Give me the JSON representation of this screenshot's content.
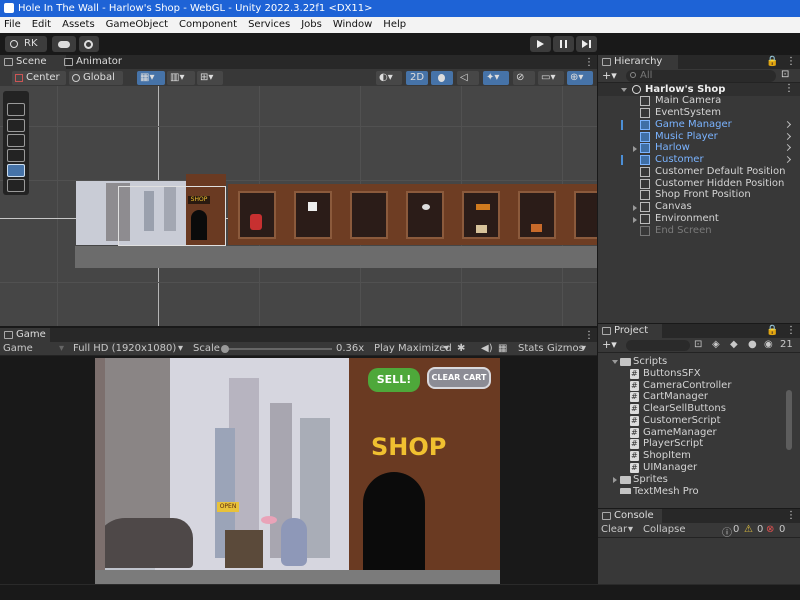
{
  "window": {
    "title": "Hole In The Wall - Harlow's Shop - WebGL - Unity 2022.3.22f1 <DX11>"
  },
  "menu": [
    "File",
    "Edit",
    "Assets",
    "GameObject",
    "Component",
    "Services",
    "Jobs",
    "Window",
    "Help"
  ],
  "toolbar": {
    "account": "RK"
  },
  "scene_panel": {
    "tabs": [
      "Scene",
      "Animator"
    ],
    "pivot": "Center",
    "space": "Global",
    "mode_2d": "2D",
    "shop_sign": "SHOP"
  },
  "hierarchy": {
    "tab": "Hierarchy",
    "search_placeholder": "All",
    "root": "Harlow's Shop",
    "items": [
      {
        "label": "Main Camera"
      },
      {
        "label": "EventSystem"
      },
      {
        "label": "Game Manager"
      },
      {
        "label": "Music Player"
      },
      {
        "label": "Harlow"
      },
      {
        "label": "Customer"
      },
      {
        "label": "Customer Default Position"
      },
      {
        "label": "Customer Hidden Position"
      },
      {
        "label": "Shop Front Position"
      },
      {
        "label": "Canvas"
      },
      {
        "label": "Environment"
      },
      {
        "label": "End Screen"
      }
    ]
  },
  "game_panel": {
    "tab": "Game",
    "display": "Game",
    "resolution": "Full HD (1920x1080)",
    "scale_label": "Scale",
    "scale_value": "0.36x",
    "play_mode": "Play Maximized",
    "stats": "Stats",
    "gizmos": "Gizmos",
    "sell_button": "SELL!",
    "clear_cart_button": "CLEAR CART",
    "shop_sign": "SHOP",
    "open_sign": "OPEN"
  },
  "project": {
    "tab": "Project",
    "count": "21",
    "folder": "Scripts",
    "scripts": [
      "ButtonsSFX",
      "CameraController",
      "CartManager",
      "ClearSellButtons",
      "CustomerScript",
      "GameManager",
      "PlayerScript",
      "ShopItem",
      "UIManager"
    ],
    "folders_after": [
      "Sprites",
      "TextMesh Pro"
    ]
  },
  "console": {
    "tab": "Console",
    "clear": "Clear",
    "collapse": "Collapse",
    "info_count": "0",
    "warn_count": "0",
    "error_count": "0"
  },
  "colors": {
    "accent": "#4673a8",
    "hierarchy_highlight": "#7ab3ff",
    "shop_wall": "#6a3a22",
    "title_bar": "#1e63d6"
  }
}
